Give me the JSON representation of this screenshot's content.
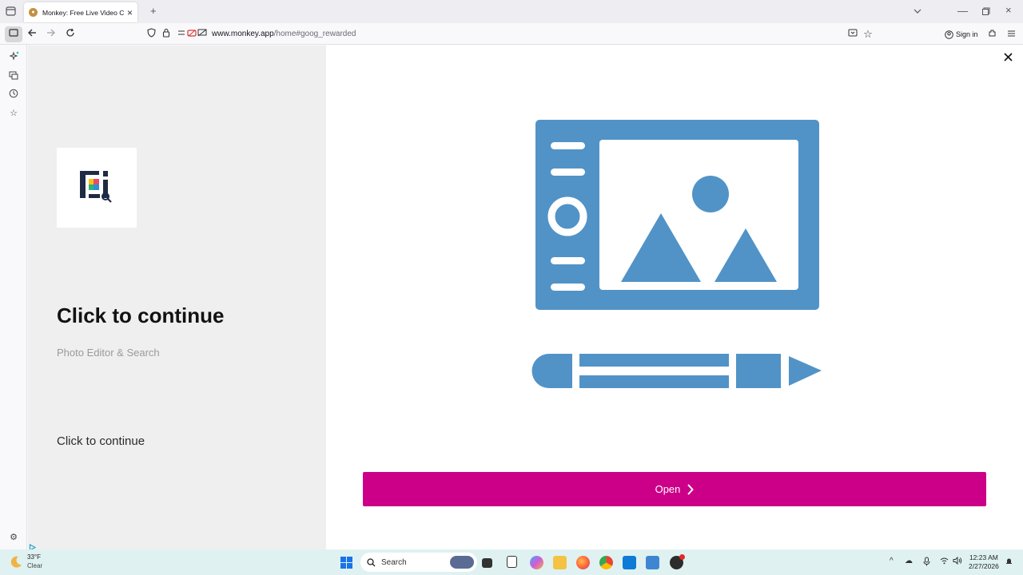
{
  "browser": {
    "tab_title": "Monkey: Free Live Video Chat",
    "new_tab_symbol": "+",
    "url_host": "www.monkey.app",
    "url_path": "/home#goog_rewarded",
    "sign_in_label": "Sign in"
  },
  "ad": {
    "headline": "Click to continue",
    "subtitle": "Photo Editor & Search",
    "cta_text": "Click to continue",
    "open_button_label": "Open",
    "illustration_color": "#5193c7",
    "button_color": "#cc0088"
  },
  "taskbar": {
    "temperature": "33°F",
    "condition": "Clear",
    "search_placeholder": "Search",
    "time": "12:23 AM",
    "date": "2/27/2026"
  },
  "icons": [
    "tab-list-icon",
    "back-icon",
    "forward-icon",
    "reload-icon",
    "shield-icon",
    "lock-icon",
    "ai-icon",
    "synced-tabs-icon",
    "history-icon",
    "bookmarks-icon",
    "settings-icon",
    "close-icon",
    "chevron-right-icon",
    "windows-start-icon",
    "search-icon"
  ]
}
